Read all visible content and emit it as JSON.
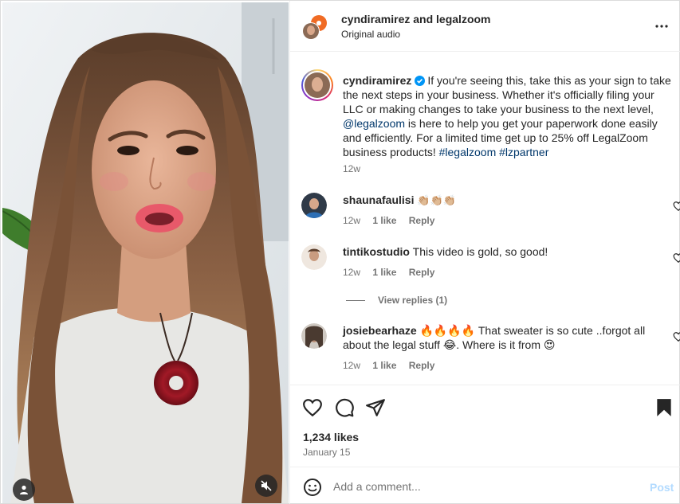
{
  "header": {
    "title": "cyndiramirez and legalzoom",
    "subtitle": "Original audio",
    "more_icon": "more-horizontal-icon"
  },
  "caption": {
    "username": "cyndiramirez",
    "text_part1": "If you're seeing this, take this as your sign to take the next steps in your business. Whether it's officially filing your LLC or making changes to take your business to the next level,",
    "mention": "@legalzoom",
    "text_part2": "is here to help you get your paperwork done easily and efficiently. For a limited time get up to 25% off LegalZoom business products!",
    "hashtag1": "#legalzoom",
    "hashtag2": "#lzpartner",
    "time": "12w"
  },
  "comments": [
    {
      "username": "shaunafaulisi",
      "text": "👏🏼👏🏼👏🏼",
      "time": "12w",
      "likes": "1 like",
      "reply": "Reply"
    },
    {
      "username": "tintikostudio",
      "text": "This video is gold, so good!",
      "time": "12w",
      "likes": "1 like",
      "reply": "Reply"
    },
    {
      "username": "josiebearhaze",
      "text": "🔥🔥🔥🔥 That sweater is so cute ..forgot all about the legal stuff 😂. Where is it from 😍",
      "time": "12w",
      "likes": "1 like",
      "reply": "Reply"
    }
  ],
  "view_replies": "View replies (1)",
  "actions": {
    "likes": "1,234 likes",
    "date": "January 15"
  },
  "composer": {
    "placeholder": "Add a comment...",
    "post_label": "Post"
  },
  "colors": {
    "link": "#00376b",
    "verified": "#0095f6",
    "post_disabled": "#b3dbff",
    "muted_text": "#737373"
  }
}
